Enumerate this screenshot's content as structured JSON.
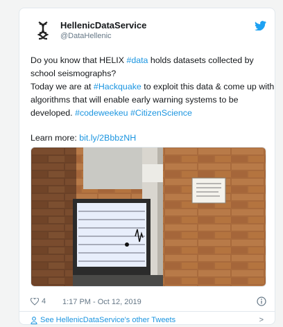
{
  "author": {
    "display_name": "HellenicDataService",
    "handle": "@DataHellenic"
  },
  "tweet": {
    "line1_a": "Do you know that HELIX ",
    "line1_tag": "#data",
    "line1_b": " holds datasets collected by",
    "line2": "school seismographs?",
    "line3_a": "Today we are at ",
    "line3_tag": "#Hackquake",
    "line3_b": " to exploit this data & come up with",
    "line4": "algorithms that will enable early warning systems to be",
    "line5_a": "developed. ",
    "line5_tag1": "#codeweekeu",
    "line5_tag2": "#CitizenScience",
    "learn_label": "Learn more: ",
    "learn_link": "bit.ly/2BbbzNH"
  },
  "meta": {
    "likes": "4",
    "timestamp": "1:17 PM - Oct 12, 2019"
  },
  "footer": {
    "label": "See HellenicDataService's other Tweets",
    "chevron": ">"
  },
  "icons": {
    "logo": "dna-helix-icon",
    "twitter": "twitter-bird-icon",
    "like": "heart-outline-icon",
    "info": "info-circle-icon",
    "profile": "person-icon"
  },
  "colors": {
    "link": "#1b95e0",
    "text": "#14171a",
    "muted": "#657786",
    "border": "#e1e8ed"
  }
}
